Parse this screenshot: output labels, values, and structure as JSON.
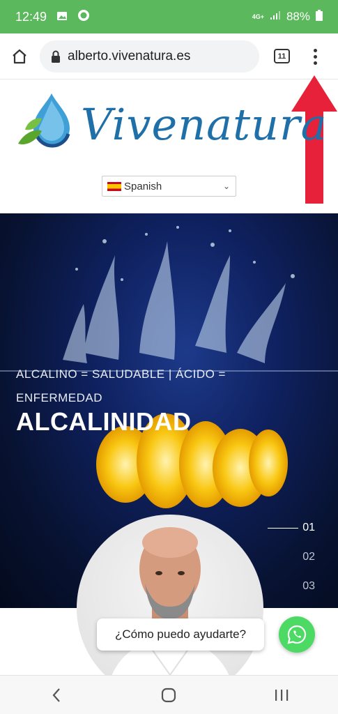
{
  "status_bar": {
    "time": "12:49",
    "network": "4G+",
    "battery": "88%"
  },
  "browser": {
    "url": "alberto.vivenatura.es",
    "tab_count": "11"
  },
  "site": {
    "logo_text": "Vivenatura",
    "language": {
      "selected": "Spanish"
    }
  },
  "hero": {
    "subtitle": "ALCALINO = SALUDABLE | ÁCIDO = ENFERMEDAD",
    "title": "ALCALINIDAD",
    "slides": [
      "01",
      "02",
      "03"
    ],
    "active_slide": 0
  },
  "chat": {
    "prompt": "¿Cómo puedo ayudarte?"
  },
  "icons": {
    "home": "home-icon",
    "lock": "lock-icon",
    "menu": "more-vert-icon",
    "whatsapp": "whatsapp-icon",
    "back": "back-icon",
    "nav_home": "circle-home-icon",
    "recents": "recents-icon"
  },
  "colors": {
    "status_bar": "#5cb85c",
    "brand_blue": "#1f6fa8",
    "arrow_red": "#e8213a",
    "whatsapp_green": "#4cd964"
  }
}
